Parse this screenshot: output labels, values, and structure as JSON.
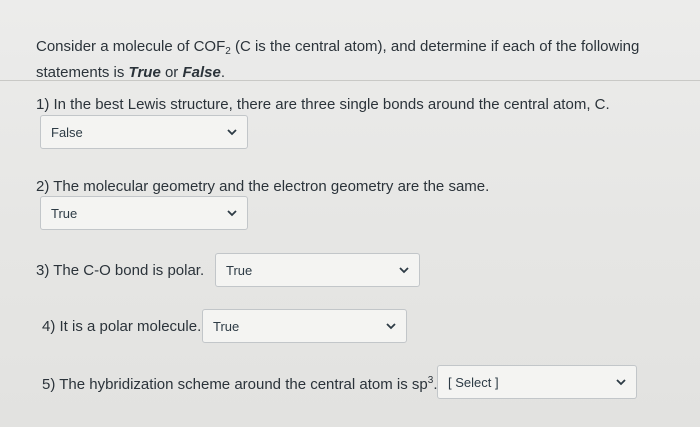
{
  "intro": {
    "prefix": "Consider a molecule of COF",
    "subscript": "2",
    "middle": " (C is the central atom), and determine if each of the following statements is ",
    "true_word": "True",
    "or_word": " or ",
    "false_word": "False",
    "end": "."
  },
  "questions": [
    {
      "text": "1) In the best Lewis structure, there are three single bonds around the central atom, C.",
      "selected": "False"
    },
    {
      "text": "2) The molecular geometry and the electron geometry are the same.",
      "selected": "True"
    },
    {
      "text": "3) The C-O bond is polar.",
      "selected": "True"
    },
    {
      "text": "4) It is a polar molecule.",
      "selected": "True"
    },
    {
      "text_prefix": "5) The hybridization scheme around the central atom is sp",
      "superscript": "3",
      "text_end": ".",
      "selected": "[ Select ]"
    }
  ],
  "icons": {
    "dropdown": "chevron-down-icon"
  }
}
